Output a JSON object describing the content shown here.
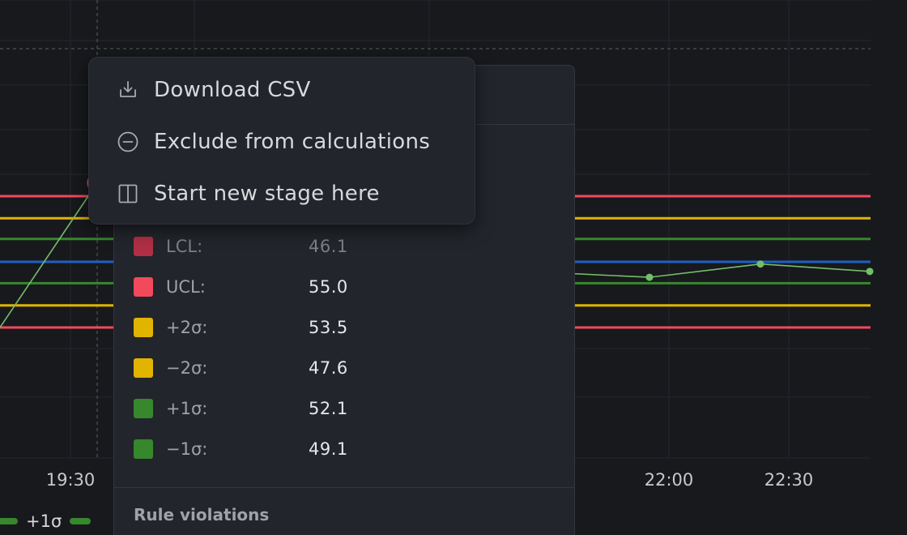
{
  "chart_data": {
    "type": "line",
    "x_ticks": [
      "19:30",
      "22:00",
      "22:30"
    ],
    "series": [
      {
        "values": [
          46.1,
          55.9,
          49.9,
          49.5,
          50.4,
          49.9
        ]
      }
    ],
    "limits": {
      "UCL": 55.0,
      "LCL": 46.1,
      "plus_2sigma": 53.5,
      "minus_2sigma": 47.6,
      "plus_1sigma": 52.1,
      "minus_1sigma": 49.1,
      "center": 50.55
    },
    "colors": {
      "series": "#73bf69",
      "ucl": "#f2495c",
      "sigma2": "#e0b400",
      "sigma1": "#37872d",
      "center": "#1f60c4",
      "highlight": "#f2495c"
    },
    "grid": true
  },
  "legend": {
    "items": [
      {
        "label": "+1σ"
      }
    ]
  },
  "context_menu": {
    "items": [
      {
        "label": "Download CSV",
        "icon": "download-icon"
      },
      {
        "label": "Exclude from calculations",
        "icon": "minus-circle-icon"
      },
      {
        "label": "Start new stage here",
        "icon": "split-columns-icon"
      }
    ]
  },
  "tooltip": {
    "rows": [
      {
        "label": "LCL:",
        "value": "46.1",
        "color": "#b02f44",
        "dim": true
      },
      {
        "label": "UCL:",
        "value": "55.0",
        "color": "#f2495c"
      },
      {
        "label": "+2σ:",
        "value": "53.5",
        "color": "#e0b400"
      },
      {
        "label": "−2σ:",
        "value": "47.6",
        "color": "#e0b400"
      },
      {
        "label": "+1σ:",
        "value": "52.1",
        "color": "#37872d"
      },
      {
        "label": "−1σ:",
        "value": "49.1",
        "color": "#37872d"
      }
    ],
    "section_title": "Rule violations"
  }
}
